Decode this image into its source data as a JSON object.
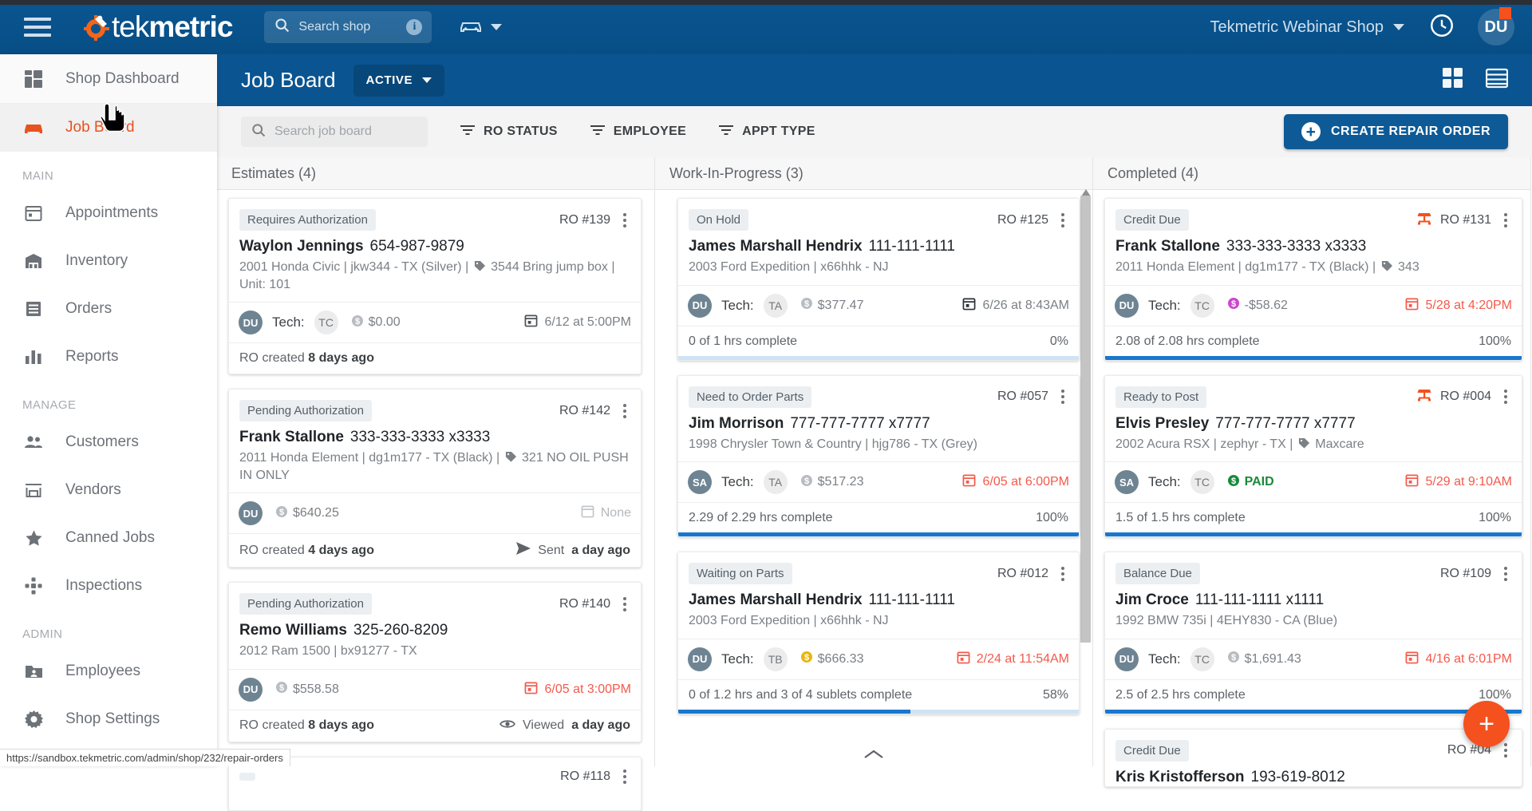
{
  "topbar": {
    "brand": "tekmetric",
    "brand_prefix": "tek",
    "brand_suffix": "metric",
    "search_placeholder": "Search shop",
    "info_icon": "info-icon",
    "shop_name": "Tekmetric Webinar Shop",
    "avatar_initials": "DU"
  },
  "sidebar": {
    "dashboard": {
      "label": "Shop Dashboard",
      "icon": "dashboard-icon"
    },
    "jobboard": {
      "label": "Job Board",
      "icon": "car-icon"
    },
    "sections": [
      {
        "title": "MAIN",
        "items": [
          {
            "label": "Appointments",
            "icon": "calendar-icon"
          },
          {
            "label": "Inventory",
            "icon": "warehouse-icon"
          },
          {
            "label": "Orders",
            "icon": "receipt-icon"
          },
          {
            "label": "Reports",
            "icon": "bar-chart-icon"
          }
        ]
      },
      {
        "title": "MANAGE",
        "items": [
          {
            "label": "Customers",
            "icon": "people-icon"
          },
          {
            "label": "Vendors",
            "icon": "store-icon"
          },
          {
            "label": "Canned Jobs",
            "icon": "star-icon"
          },
          {
            "label": "Inspections",
            "icon": "inspection-icon"
          }
        ]
      },
      {
        "title": "ADMIN",
        "items": [
          {
            "label": "Employees",
            "icon": "folder-person-icon"
          },
          {
            "label": "Shop Settings",
            "icon": "gear-icon"
          }
        ]
      }
    ]
  },
  "page_header": {
    "title": "Job Board",
    "status_filter": "ACTIVE",
    "view_grid_icon": "grid-view-icon",
    "view_list_icon": "list-view-icon"
  },
  "filter_bar": {
    "search_placeholder": "Search job board",
    "filters": [
      {
        "label": "RO STATUS",
        "icon": "filter-icon"
      },
      {
        "label": "EMPLOYEE",
        "icon": "filter-icon"
      },
      {
        "label": "APPT TYPE",
        "icon": "filter-icon"
      }
    ],
    "create_button": "CREATE REPAIR ORDER"
  },
  "status_url": "https://sandbox.tekmetric.com/admin/shop/232/repair-orders",
  "fab_label": "+",
  "columns": [
    {
      "title": "Estimates (4)",
      "cards": [
        {
          "tag": "Requires Authorization",
          "ro": "RO #139",
          "customer": "Waylon Jennings",
          "phone": "654-987-9879",
          "vehicle": "2001 Honda Civic | jkw344 - TX (Silver) |",
          "tag_text": "3544 Bring jump box |",
          "unit": "Unit: 101",
          "avatar": "DU",
          "tech_label": "Tech:",
          "tech": "TC",
          "amount": "$0.00",
          "amount_state": "neutral",
          "due": "6/12 at 5:00PM",
          "due_state": "normal",
          "due_icon": "calendar-icon",
          "footer_left_prefix": "RO created",
          "footer_left_value": "8 days ago",
          "footer_right": "",
          "footer_right_icon": "",
          "progress": null
        },
        {
          "tag": "Pending Authorization",
          "ro": "RO #142",
          "customer": "Frank Stallone",
          "phone": "333-333-3333 x3333",
          "vehicle": "2011 Honda Element | dg1m177 - TX (Black) |",
          "tag_text": "321 NO OIL PUSH IN ONLY",
          "unit": "",
          "avatar": "DU",
          "tech_label": "",
          "tech": "",
          "amount": "$640.25",
          "amount_state": "neutral",
          "due": "None",
          "due_state": "muted",
          "due_icon": "calendar-icon",
          "footer_left_prefix": "RO created",
          "footer_left_value": "4 days ago",
          "footer_right_prefix": "Sent",
          "footer_right_value": "a day ago",
          "footer_right_icon": "send-icon",
          "progress": null
        },
        {
          "tag": "Pending Authorization",
          "ro": "RO #140",
          "customer": "Remo Williams",
          "phone": "325-260-8209",
          "vehicle": "2012 Ram 1500 | bx91277 - TX",
          "tag_text": "",
          "unit": "",
          "avatar": "DU",
          "tech_label": "",
          "tech": "",
          "amount": "$558.58",
          "amount_state": "neutral",
          "due": "6/05 at 3:00PM",
          "due_state": "due",
          "due_icon": "calendar-icon",
          "footer_left_prefix": "RO created",
          "footer_left_value": "8 days ago",
          "footer_right_prefix": "Viewed",
          "footer_right_value": "a day ago",
          "footer_right_icon": "eye-icon",
          "progress": null
        },
        {
          "tag": "",
          "ro": "RO #118",
          "customer": "",
          "phone": "",
          "vehicle": "",
          "tag_text": "",
          "unit": "",
          "avatar": "",
          "tech_label": "",
          "tech": "",
          "amount": "",
          "amount_state": "neutral",
          "due": "",
          "due_state": "normal",
          "due_icon": "",
          "footer_left_prefix": "",
          "footer_left_value": "",
          "footer_right": "",
          "progress": null
        }
      ]
    },
    {
      "title": "Work-In-Progress (3)",
      "cards": [
        {
          "tag": "On Hold",
          "ro": "RO #125",
          "customer": "James Marshall Hendrix",
          "phone": "111-111-1111",
          "vehicle": "2003 Ford Expedition | x66hhk - NJ",
          "tag_text": "",
          "unit": "",
          "avatar": "DU",
          "tech_label": "Tech:",
          "tech": "TA",
          "amount": "$377.47",
          "amount_state": "neutral",
          "due": "6/26 at 8:43AM",
          "due_state": "normal",
          "due_icon": "calendar-icon",
          "progress": {
            "text": "0 of 1 hrs complete",
            "pct_label": "0%",
            "pct": 0
          }
        },
        {
          "tag": "Need to Order Parts",
          "ro": "RO #057",
          "customer": "Jim Morrison",
          "phone": "777-777-7777 x7777",
          "vehicle": "1998 Chrysler Town & Country | hjg786 - TX (Grey)",
          "tag_text": "",
          "unit": "",
          "avatar": "SA",
          "tech_label": "Tech:",
          "tech": "TA",
          "amount": "$517.23",
          "amount_state": "neutral",
          "due": "6/05 at 6:00PM",
          "due_state": "due",
          "due_icon": "calendar-icon",
          "progress": {
            "text": "2.29 of 2.29 hrs complete",
            "pct_label": "100%",
            "pct": 100
          }
        },
        {
          "tag": "Waiting on Parts",
          "ro": "RO #012",
          "customer": "James Marshall Hendrix",
          "phone": "111-111-1111",
          "vehicle": "2003 Ford Expedition | x66hhk - NJ",
          "tag_text": "",
          "unit": "",
          "avatar": "DU",
          "tech_label": "Tech:",
          "tech": "TB",
          "amount": "$666.33",
          "amount_state": "warn",
          "due": "2/24 at 11:54AM",
          "due_state": "due",
          "due_icon": "calendar-icon",
          "progress": {
            "text": "0 of 1.2 hrs and 3 of 4 sublets complete",
            "pct_label": "58%",
            "pct": 58
          }
        }
      ]
    },
    {
      "title": "Completed (4)",
      "cards": [
        {
          "tag": "Credit Due",
          "ro": "RO #131",
          "lift_icon": "car-lift-icon",
          "customer": "Frank Stallone",
          "phone": "333-333-3333 x3333",
          "vehicle": "2011 Honda Element | dg1m177 - TX (Black) |",
          "tag_text": "343",
          "unit": "",
          "avatar": "DU",
          "tech_label": "Tech:",
          "tech": "TC",
          "amount": "-$58.62",
          "amount_state": "credit",
          "due": "5/28 at 4:20PM",
          "due_state": "due",
          "due_icon": "calendar-icon",
          "progress": {
            "text": "2.08 of 2.08 hrs complete",
            "pct_label": "100%",
            "pct": 100
          }
        },
        {
          "tag": "Ready to Post",
          "ro": "RO #004",
          "lift_icon": "car-lift-icon",
          "customer": "Elvis Presley",
          "phone": "777-777-7777 x7777",
          "vehicle": "2002 Acura RSX | zephyr - TX |",
          "tag_text": "Maxcare",
          "unit": "",
          "avatar": "SA",
          "tech_label": "Tech:",
          "tech": "TC",
          "amount": "PAID",
          "amount_state": "paid",
          "due": "5/29 at 9:10AM",
          "due_state": "due",
          "due_icon": "calendar-icon",
          "progress": {
            "text": "1.5 of 1.5 hrs complete",
            "pct_label": "100%",
            "pct": 100
          }
        },
        {
          "tag": "Balance Due",
          "ro": "RO #109",
          "lift_icon": "",
          "customer": "Jim Croce",
          "phone": "111-111-1111 x1111",
          "vehicle": "1992 BMW 735i | 4EHY830 - CA (Blue)",
          "tag_text": "",
          "unit": "",
          "avatar": "DU",
          "tech_label": "Tech:",
          "tech": "TC",
          "amount": "$1,691.43",
          "amount_state": "neutral",
          "due": "4/16 at 6:01PM",
          "due_state": "due",
          "due_icon": "calendar-icon",
          "progress": {
            "text": "2.5 of 2.5 hrs complete",
            "pct_label": "100%",
            "pct": 100
          }
        },
        {
          "tag": "Credit Due",
          "ro": "RO #04",
          "lift_icon": "",
          "customer": "Kris Kristofferson",
          "phone": "193-619-8012",
          "vehicle": "",
          "tag_text": "",
          "unit": "",
          "avatar": "",
          "tech_label": "",
          "tech": "",
          "amount": "",
          "amount_state": "neutral",
          "due": "",
          "due_state": "normal",
          "due_icon": "",
          "progress": null
        }
      ]
    }
  ],
  "colors": {
    "brand_blue": "#0a5591",
    "accent_orange": "#e8521f",
    "progress_blue": "#1878cf",
    "due_red": "#f4594b",
    "paid_green": "#1a8a3c",
    "credit_magenta": "#cc46cc"
  }
}
